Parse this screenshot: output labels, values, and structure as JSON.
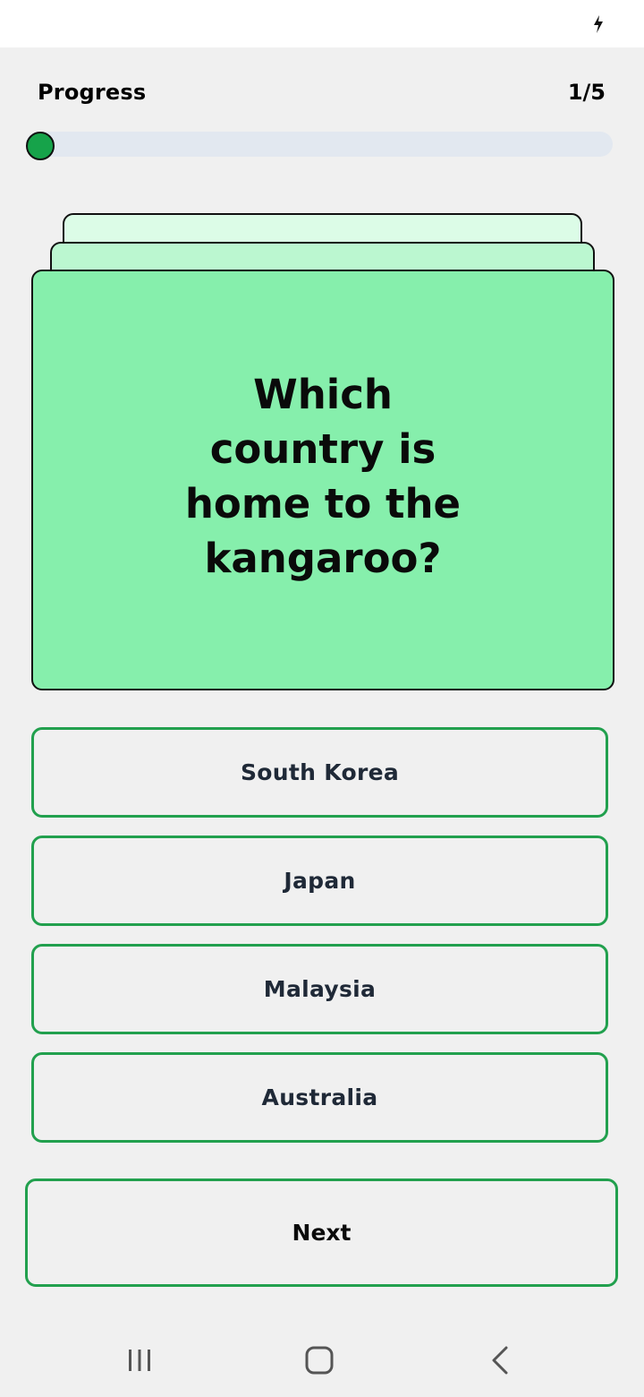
{
  "progress": {
    "label": "Progress",
    "count": "1/5",
    "current": 1,
    "total": 5,
    "fill_fraction": 0.0
  },
  "question": {
    "text": "Which country is home to the kangaroo?"
  },
  "answers": [
    {
      "label": "South Korea"
    },
    {
      "label": "Japan"
    },
    {
      "label": "Malaysia"
    },
    {
      "label": "Australia"
    }
  ],
  "next_label": "Next",
  "icons": {
    "status_bar": "lightning-bolt-icon",
    "nav_recents": "recent-apps-icon",
    "nav_home": "home-icon",
    "nav_back": "back-icon"
  },
  "colors": {
    "accent": "#16a34a",
    "answer_border": "#22a04e",
    "card_front": "#86efac",
    "card_middle": "#bbf7d0",
    "card_back": "#dcfce7",
    "track": "#e2e8f0",
    "background": "#f0f0f0"
  }
}
